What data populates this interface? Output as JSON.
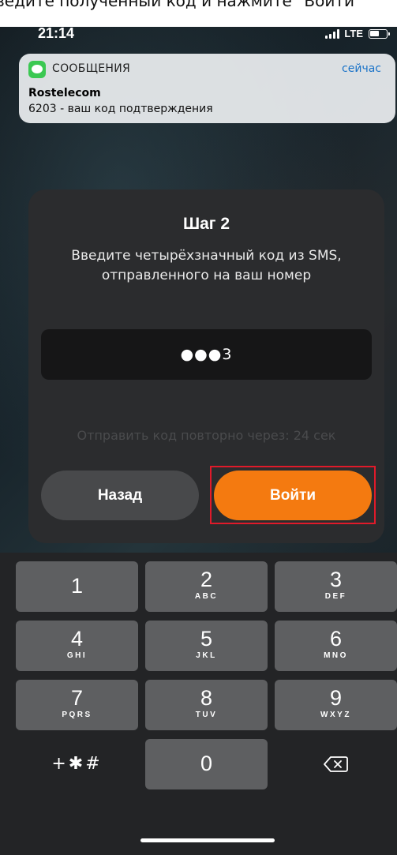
{
  "overlay_text": "ведите полученный код и нажмите \"Войти\"",
  "status_bar": {
    "time": "21:14",
    "network": "LTE"
  },
  "notification": {
    "app": "СООБЩЕНИЯ",
    "time": "сейчас",
    "title": "Rostelecom",
    "body": "6203 - ваш код подтверждения",
    "icon": "messages-icon"
  },
  "card": {
    "title": "Шаг 2",
    "description": "Введите четырёхзначный код из SMS, отправленного на ваш номер",
    "code_value": "●●●3",
    "resend_text": "Отправить код повторно через: 24 сек",
    "back_button": "Назад",
    "login_button": "Войти"
  },
  "keypad": {
    "keys": [
      {
        "digit": "1",
        "letters": ""
      },
      {
        "digit": "2",
        "letters": "ABC"
      },
      {
        "digit": "3",
        "letters": "DEF"
      },
      {
        "digit": "4",
        "letters": "GHI"
      },
      {
        "digit": "5",
        "letters": "JKL"
      },
      {
        "digit": "6",
        "letters": "MNO"
      },
      {
        "digit": "7",
        "letters": "PQRS"
      },
      {
        "digit": "8",
        "letters": "TUV"
      },
      {
        "digit": "9",
        "letters": "WXYZ"
      }
    ],
    "symbols": "+✱#",
    "zero": "0",
    "backspace_icon": "backspace-icon"
  },
  "colors": {
    "accent": "#f47a10",
    "highlight": "#e01a2a",
    "card": "#2b2c2e"
  }
}
